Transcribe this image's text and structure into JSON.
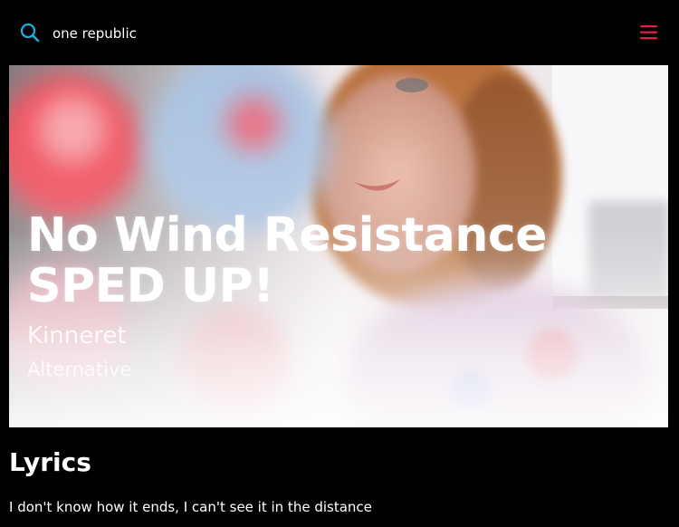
{
  "search": {
    "value": "one republic",
    "icon": "search-icon"
  },
  "header": {
    "menu_icon": "hamburger-menu-icon",
    "accent_color": "#e11d48",
    "search_icon_color": "#0ea5e9"
  },
  "song": {
    "title": "No Wind Resistance SPED UP!",
    "artist": "Kinneret",
    "genre": "Alternative"
  },
  "lyrics": {
    "heading": "Lyrics",
    "first_line": "I don't know how it ends, I can't see it in the distance"
  }
}
